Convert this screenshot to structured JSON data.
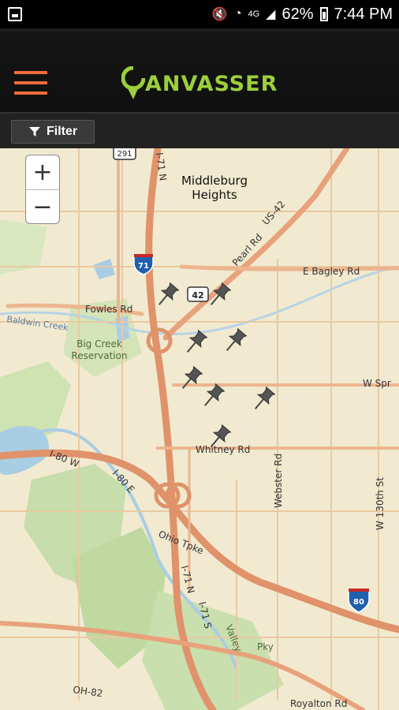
{
  "status_bar": {
    "battery": "62%",
    "time": "7:44 PM",
    "network": "4G"
  },
  "app": {
    "logo_text": "ANVASSER",
    "logo_color": "#9ccf3b",
    "menu_color": "#f26d3d"
  },
  "toolbar": {
    "filter_label": "Filter",
    "filter_icon": "funnel-icon"
  },
  "map": {
    "zoom_in": "+",
    "zoom_out": "−",
    "labels": {
      "middleburg_line1": "Middleburg",
      "middleburg_line2": "Heights",
      "pearl_rd": "Pearl Rd",
      "us42_road": "US-42",
      "us42_shield": "42",
      "i71_shield": "71",
      "i80_shield": "80",
      "sr291_shield": "291",
      "bagley_rd": "E Bagley Rd",
      "fowles_rd": "Fowles Rd",
      "baldwin_creek": "Baldwin Creek",
      "big_creek_line1": "Big Creek",
      "big_creek_line2": "Reservation",
      "w_spr": "W Spr",
      "whitney_rd": "Whitney Rd",
      "webster_rd": "Webster Rd",
      "w130th": "W 130th St",
      "i80_w": "I-80 W",
      "i80_e": "I-80 E",
      "ohio_tpke": "Ohio Tpke",
      "i71_n": "I-71 N",
      "i71_s": "I-71 S",
      "i71_n_top": "I-71 N",
      "valley_pky": "Valley",
      "pky": "Pky",
      "oh82": "OH-82",
      "royalton_rd": "Royalton Rd"
    },
    "pin_count": "8"
  }
}
